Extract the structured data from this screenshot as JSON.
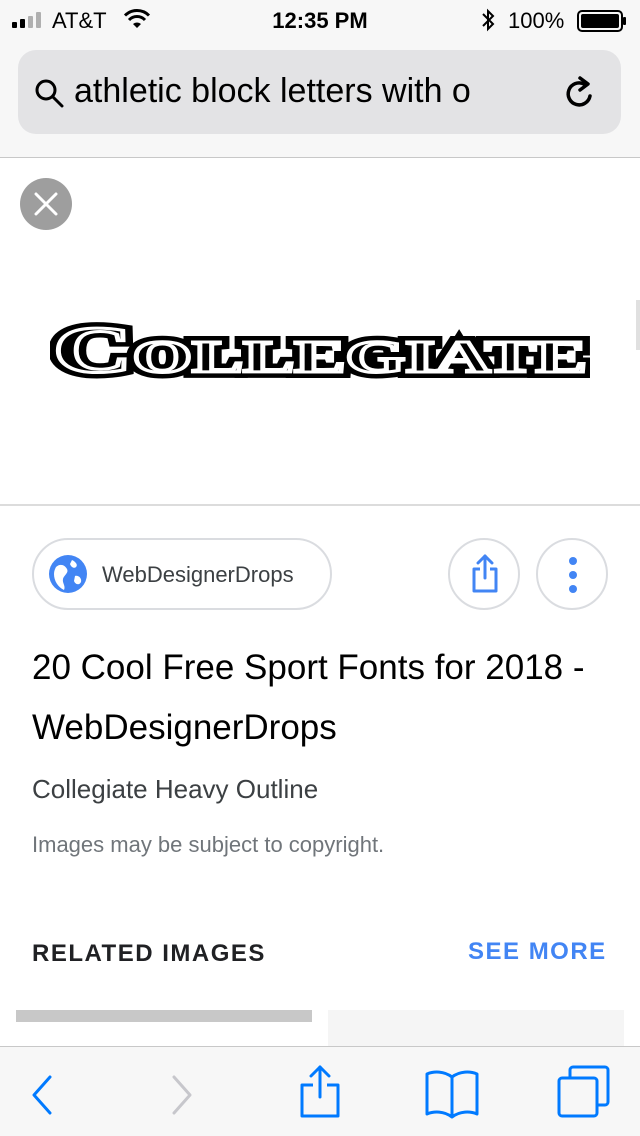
{
  "status_bar": {
    "carrier": "AT&T",
    "time": "12:35 PM",
    "battery": "100%",
    "icons": [
      "signal-icon",
      "wifi-icon",
      "bluetooth-icon",
      "battery-icon"
    ]
  },
  "address_bar": {
    "query": "athletic block letters with o",
    "icons": [
      "search-icon",
      "reload-icon"
    ]
  },
  "image": {
    "word": "Collegiate"
  },
  "result": {
    "source": "WebDesignerDrops",
    "title": "20 Cool Free Sport Fonts for 2018 - WebDesignerDrops",
    "subtitle": "Collegiate Heavy Outline",
    "copyright": "Images may be subject to copyright."
  },
  "related": {
    "heading": "RELATED IMAGES",
    "see_more": "SEE MORE"
  },
  "toolbar": {
    "icons": [
      "back-icon",
      "forward-icon",
      "share-icon",
      "bookmarks-icon",
      "tabs-icon"
    ]
  },
  "colors": {
    "accent": "#4285f4",
    "share_icon": "#4285f4",
    "safari_blue": "#007aff"
  }
}
